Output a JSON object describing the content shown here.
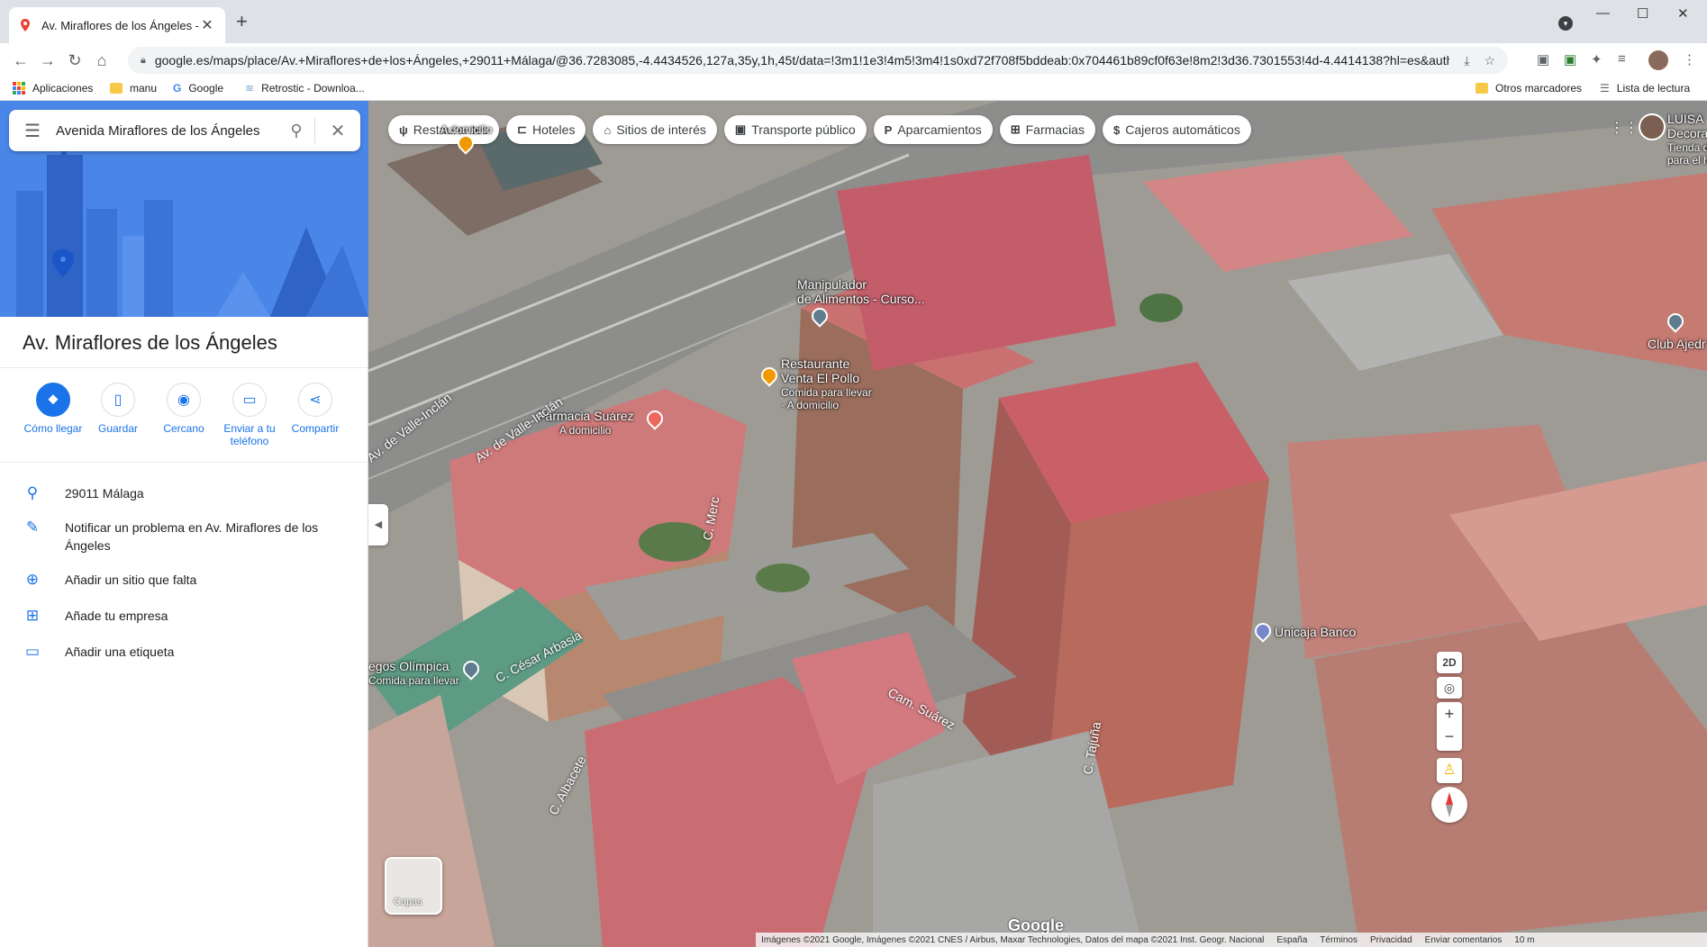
{
  "browser": {
    "tab_title": "Av. Miraflores de los Ángeles - G",
    "url": "google.es/maps/place/Av.+Miraflores+de+los+Ángeles,+29011+Málaga/@36.7283085,-4.4434526,127a,35y,1h,45t/data=!3m1!1e3!4m5!3m4!1s0xd72f708f5bddeab:0x704461b89cf0f63e!8m2!3d36.7301553!4d-4.4414138?hl=es&auth...",
    "bookmarks": [
      {
        "label": "Aplicaciones",
        "icon": "apps-grid-icon"
      },
      {
        "label": "manu",
        "icon": "folder-icon"
      },
      {
        "label": "Google",
        "icon": "google-icon"
      },
      {
        "label": "Retrostic - Downloa...",
        "icon": "retrostic-icon"
      }
    ],
    "other_bookmarks": "Otros marcadores",
    "reading_list": "Lista de lectura"
  },
  "panel": {
    "search_value": "Avenida Miraflores de los Ángeles",
    "place_title": "Av. Miraflores de los Ángeles",
    "actions": [
      {
        "label": "Cómo llegar",
        "icon": "directions-icon"
      },
      {
        "label": "Guardar",
        "icon": "bookmark-icon"
      },
      {
        "label": "Cercano",
        "icon": "nearby-icon"
      },
      {
        "label": "Enviar a tu teléfono",
        "icon": "phone-icon"
      },
      {
        "label": "Compartir",
        "icon": "share-icon"
      }
    ],
    "info": [
      {
        "label": "29011 Málaga",
        "icon": "location-pin-icon"
      },
      {
        "label": "Notificar un problema en Av. Miraflores de los Ángeles",
        "icon": "pencil-icon"
      },
      {
        "label": "Añadir un sitio que falta",
        "icon": "add-place-icon"
      },
      {
        "label": "Añade tu empresa",
        "icon": "add-business-icon"
      },
      {
        "label": "Añadir una etiqueta",
        "icon": "label-icon"
      }
    ]
  },
  "map": {
    "chips": [
      {
        "label": "Restaurantes",
        "icon": "restaurant-icon"
      },
      {
        "label": "Hoteles",
        "icon": "hotel-icon"
      },
      {
        "label": "Sitios de interés",
        "icon": "attraction-icon"
      },
      {
        "label": "Transporte público",
        "icon": "transit-icon"
      },
      {
        "label": "Aparcamientos",
        "icon": "parking-icon"
      },
      {
        "label": "Farmacias",
        "icon": "pharmacy-icon"
      },
      {
        "label": "Cajeros automáticos",
        "icon": "atm-icon"
      }
    ],
    "labels": {
      "mcdonalds_sub": "A domicilio",
      "manipulador_line1": "Manipulador",
      "manipulador_line2": "de Alimentos - Curso...",
      "restaurante_line1": "Restaurante",
      "restaurante_line2": "Venta El Pollo",
      "restaurante_sub1": "Comida para llevar",
      "restaurante_sub2": "· A domicilio",
      "farmacia_line1": "Farmacia Suárez",
      "farmacia_sub": "A domicilio",
      "juegos_line1": "egos Olímpica",
      "juegos_sub": "Comida para llevar",
      "unicaja": "Unicaja Banco",
      "club": "Club Ajedr",
      "luisa_line1": "LUISA",
      "luisa_line2": "Decora",
      "luisa_line3": "Tienda d",
      "luisa_line4": "para el h"
    },
    "streets": {
      "valle1": "Av. de Valle-Inclán",
      "valle2": "Av. de Valle-Inclán",
      "merc": "C. Merc",
      "cesar": "C. César Arbasia",
      "albacete": "C. Albacete",
      "suarez": "Cam. Suárez",
      "tajuna": "C. Tajuña"
    },
    "layers_label": "Capas",
    "btn_2d": "2D",
    "zoom_in": "+",
    "zoom_out": "−",
    "logo": "Google",
    "footer": {
      "attribution": "Imágenes ©2021 Google, Imágenes ©2021 CNES / Airbus, Maxar Technologies, Datos del mapa ©2021 Inst. Geogr. Nacional",
      "country": "España",
      "terms": "Términos",
      "privacy": "Privacidad",
      "feedback": "Enviar comentarios",
      "scale": "10 m"
    }
  }
}
